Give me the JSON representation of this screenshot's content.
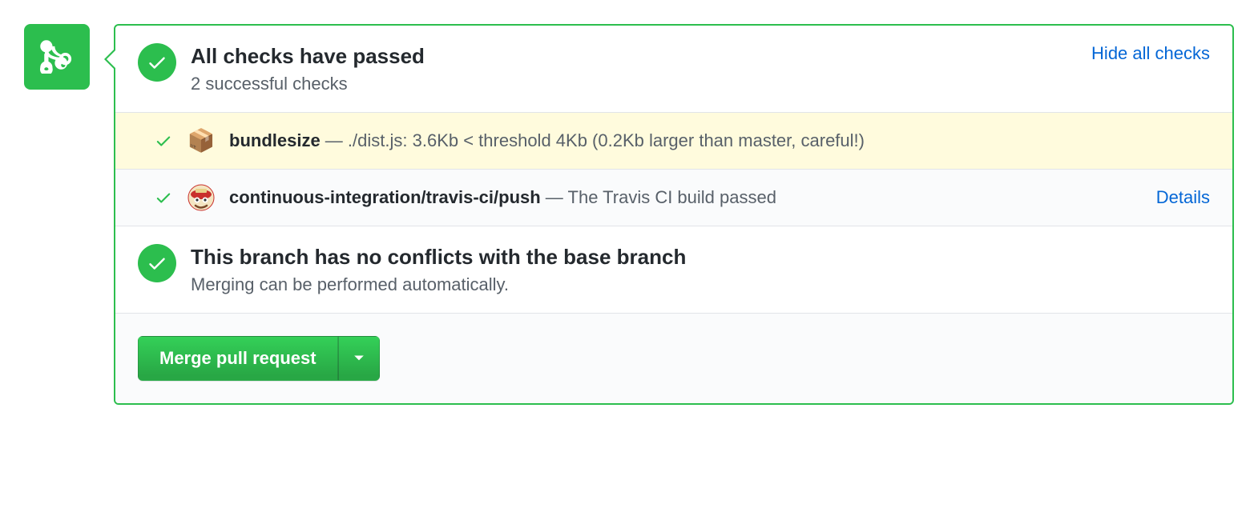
{
  "status": {
    "title": "All checks have passed",
    "subtitle": "2 successful checks",
    "hide_link": "Hide all checks"
  },
  "checks": [
    {
      "name": "bundlesize",
      "separator": " — ",
      "desc": "./dist.js: 3.6Kb < threshold 4Kb (0.2Kb larger than master, careful!)",
      "highlight": true,
      "icon": "package"
    },
    {
      "name": "continuous-integration/travis-ci/push",
      "separator": " — ",
      "desc": "The Travis CI build passed",
      "highlight": false,
      "icon": "travis",
      "details": "Details"
    }
  ],
  "conflict": {
    "title": "This branch has no conflicts with the base branch",
    "subtitle": "Merging can be performed automatically."
  },
  "merge_button": "Merge pull request"
}
